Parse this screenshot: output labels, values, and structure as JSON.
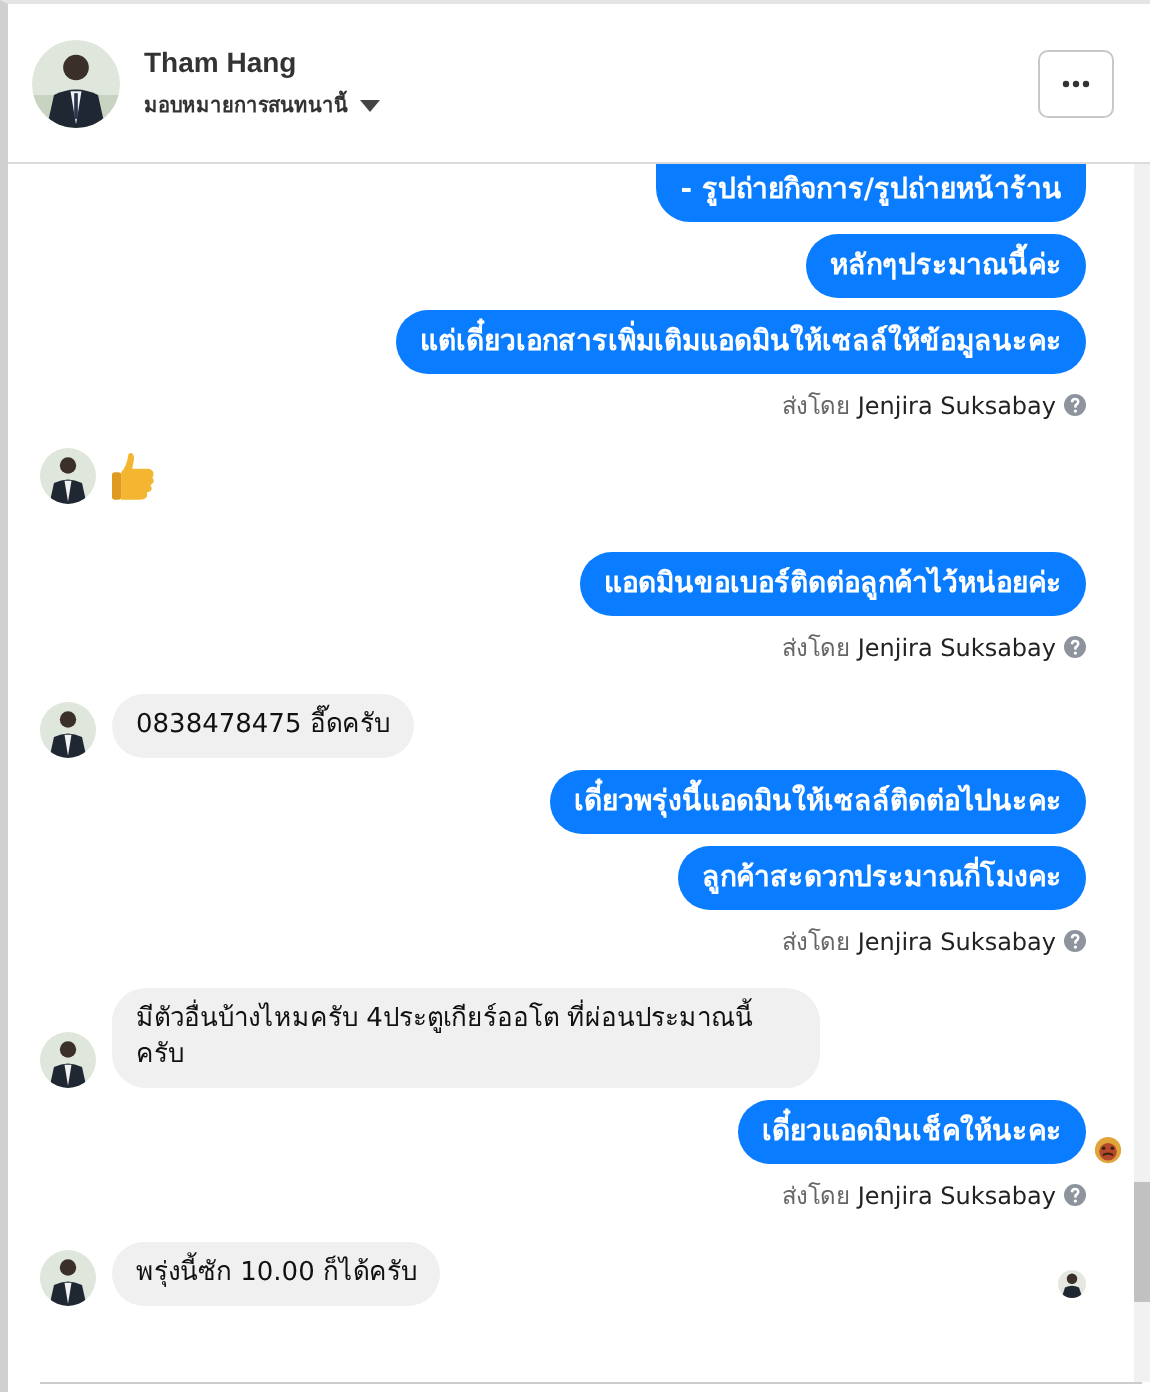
{
  "header": {
    "name": "Tham Hang",
    "assign_label": "มอบหมายการสนทนานี้"
  },
  "messages": [
    {
      "kind": "outgoing",
      "text": "- รูปถ่ายกิจการ/รูปถ่ายหน้าร้าน",
      "cut": true
    },
    {
      "kind": "outgoing",
      "text": "หลักๆประมาณนี้ค่ะ"
    },
    {
      "kind": "outgoing",
      "text": "แต่เดี๋ยวเอกสารเพิ่มเติมแอดมินให้เซลล์ให้ข้อมูลนะคะ"
    },
    {
      "kind": "sent_by",
      "label": "ส่งโดย",
      "name": "Jenjira Suksabay"
    },
    {
      "kind": "thumb"
    },
    {
      "kind": "outgoing",
      "text": "แอดมินขอเบอร์ติดต่อลูกค้าไว้หน่อยค่ะ"
    },
    {
      "kind": "sent_by",
      "label": "ส่งโดย",
      "name": "Jenjira Suksabay"
    },
    {
      "kind": "incoming",
      "text": "0838478475 อี๊ดครับ"
    },
    {
      "kind": "outgoing",
      "text": "เดี๋ยวพรุ่งนี้แอดมินให้เซลล์ติดต่อไปนะคะ"
    },
    {
      "kind": "outgoing",
      "text": "ลูกค้าสะดวกประมาณกี่โมงคะ"
    },
    {
      "kind": "sent_by",
      "label": "ส่งโดย",
      "name": "Jenjira Suksabay"
    },
    {
      "kind": "incoming",
      "text": "มีตัวอื่นบ้างไหมครับ 4ประตูเกียร์ออโต ที่ผ่อนประมาณนี้ครับ"
    },
    {
      "kind": "outgoing",
      "text": "เดี๋ยวแอดมินเช็คให้นะคะ",
      "reaction": true
    },
    {
      "kind": "sent_by",
      "label": "ส่งโดย",
      "name": "Jenjira Suksabay"
    },
    {
      "kind": "incoming",
      "text": "พรุ่งนี้ซัก 10.00 ก็ได้ครับ",
      "seen": true
    }
  ]
}
